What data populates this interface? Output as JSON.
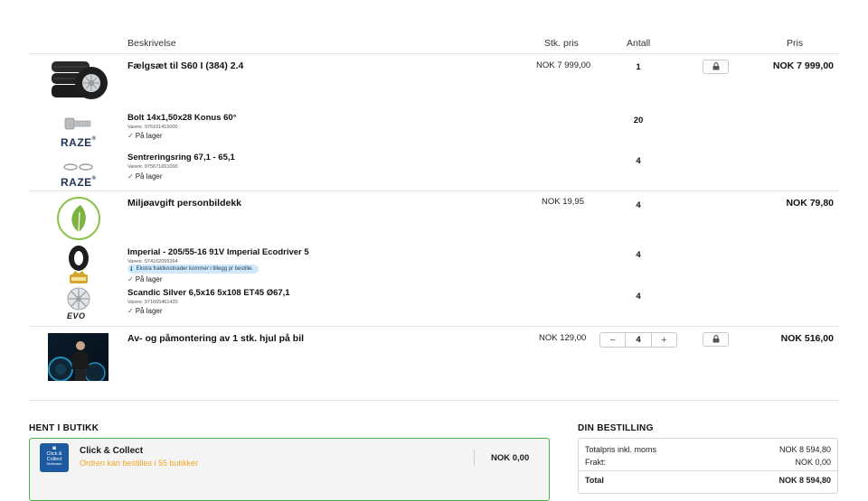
{
  "columns": {
    "description": "Beskrivelse",
    "unit_price": "Stk. pris",
    "quantity": "Antall",
    "price": "Pris"
  },
  "items": [
    {
      "title": "Fælgsæt til S60 I (384) 2.4",
      "unit_price": "NOK 7 999,00",
      "quantity": "1",
      "total": "NOK 7 999,00",
      "icon": "tire-set-icon",
      "subitems": [
        {
          "brand": "RAZE",
          "brand_mark": "®",
          "title": "Bolt 14x1,50x28 Konus 60°",
          "varenr": "Varenr. 976101415000",
          "stock": "På lager",
          "quantity": "20"
        },
        {
          "brand": "RAZE",
          "brand_mark": "®",
          "title": "Sentreringsring 67,1 - 65,1",
          "varenr": "Varenr. 975671651000",
          "stock": "På lager",
          "quantity": "4"
        }
      ]
    },
    {
      "title": "Miljøavgift personbildekk",
      "unit_price": "NOK 19,95",
      "quantity": "4",
      "total": "NOK 79,80",
      "icon": "leaf-icon",
      "subitems": [
        {
          "title": "Imperial - 205/55-16 91V Imperial Ecodriver 5",
          "varenr": "Varenr. 974162055264",
          "info": "Ekstra fraktkostnader kommer i tillegg pr bestille.",
          "stock": "På lager",
          "quantity": "4"
        },
        {
          "brand": "EVO",
          "title": "Scandic Silver 6,5x16 5x108 ET45 Ø67,1",
          "varenr": "Varenr. 971665461420",
          "stock": "På lager",
          "quantity": "4"
        }
      ]
    },
    {
      "title": "Av- og påmontering av 1 stk. hjul på bil",
      "unit_price": "NOK 129,00",
      "quantity": "4",
      "total": "NOK 516,00",
      "stepper": {
        "minus": "−",
        "plus": "+"
      }
    }
  ],
  "pickup": {
    "heading": "HENT I BUTIKK",
    "option_title": "Click & Collect",
    "option_subtitle": "Ordren kan bestilles i 55 butikker",
    "option_price": "NOK 0,00",
    "logo_line1": "Click &",
    "logo_line2": "Collect",
    "logo_line3": "Dekkmann",
    "accent": "#f5a623",
    "border": "#4caf50"
  },
  "order": {
    "heading": "DIN BESTILLING",
    "rows": [
      {
        "label": "Totalpris inkl. moms",
        "value": "NOK 8 594,80"
      },
      {
        "label": "Frakt:",
        "value": "NOK 0,00"
      }
    ],
    "total_label": "Total",
    "total_value": "NOK 8 594,80"
  },
  "colors": {
    "stock_check": "#2e7d32",
    "info_bg": "#cfe8fb",
    "brand_blue": "#1e3355",
    "leaf_green": "#7cb342"
  }
}
